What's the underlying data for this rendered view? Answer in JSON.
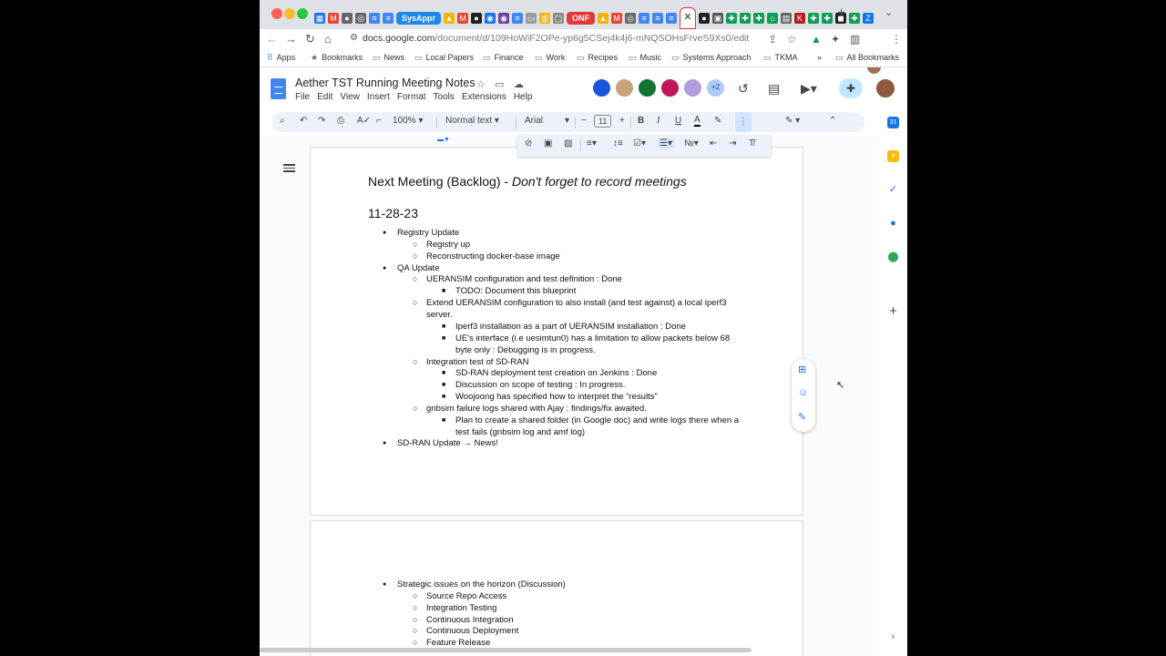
{
  "browser": {
    "badges": {
      "sysappr": "SysAppr",
      "onf": "ONF"
    },
    "url": {
      "host": "docs.google.com",
      "path": "/document/d/109HoWiF2OPe-yp6g5CSej4k4j6-mNQSOHsFrveS9Xs0/edit"
    },
    "bookmarks": [
      "Apps",
      "Bookmarks",
      "News",
      "Local Papers",
      "Finance",
      "Work",
      "Recipes",
      "Music",
      "Systems Approach",
      "TKMA",
      "All Bookmarks"
    ]
  },
  "docs": {
    "title": "Aether TST Running Meeting Notes",
    "menu": [
      "File",
      "Edit",
      "View",
      "Insert",
      "Format",
      "Tools",
      "Extensions",
      "Help"
    ],
    "collab_extra": "+2",
    "toolbar": {
      "zoom": "100%",
      "style": "Normal text",
      "font": "Arial",
      "font_size": "11"
    }
  },
  "document": {
    "heading": "Next Meeting (Backlog) - ",
    "heading_italic": "Don't forget to record meetings",
    "date": "11-28-23",
    "lines": [
      "Registry Update",
      "Registry up",
      "Reconstructing docker-base image",
      "QA Update",
      "UERANSIM configuration and test definition : Done",
      "TODO: Document this blueprint",
      "Extend UERANSIM configuration to also install (and test against) a local iperf3 server.",
      "Iperf3 installation as a part of UERANSIM installation : Done",
      "UE's interface (i.e uesimtun0) has a limitation to allow packets below 68 byte only : Debugging is in progress.",
      "Integration test of SD-RAN",
      "SD-RAN deployment test creation on Jenkins : Done",
      "Discussion on scope of testing : In progress.",
      "Woojoong has specified how to interpret the “results”",
      "gnbsim failure logs shared with Ajay : findings/fix awaited.",
      "Plan to create a shared folder (in Google doc) and write logs there when a test fails (gnbsim log and amf log)",
      "SD-RAN Update → News!"
    ],
    "page2_lines": [
      "Strategic issues on the horizon (Discussion)",
      "Source Repo Access",
      "Integration Testing",
      "Continuous Integration",
      "Continuous Deployment",
      "Feature Release"
    ]
  }
}
